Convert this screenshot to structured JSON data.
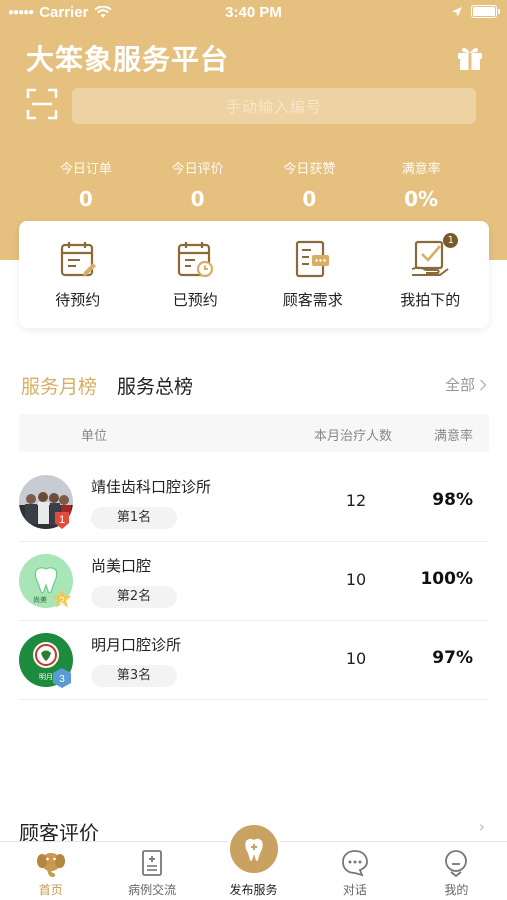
{
  "status_bar": {
    "carrier": "Carrier",
    "time": "3:40 PM"
  },
  "header": {
    "title": "大笨象服务平台",
    "search_placeholder": "手动输入编号"
  },
  "stats": [
    {
      "label": "今日订单",
      "value": "0"
    },
    {
      "label": "今日评价",
      "value": "0"
    },
    {
      "label": "今日获赞",
      "value": "0"
    },
    {
      "label": "满意率",
      "value": "0%"
    }
  ],
  "actions": [
    {
      "label": "待预约",
      "icon": "calendar-edit-icon"
    },
    {
      "label": "已预约",
      "icon": "calendar-clock-icon"
    },
    {
      "label": "顾客需求",
      "icon": "document-chat-icon"
    },
    {
      "label": "我拍下的",
      "icon": "hand-check-icon",
      "badge": "1"
    }
  ],
  "ranking": {
    "tab_active": "服务月榜",
    "tab_other": "服务总榜",
    "view_all": "全部",
    "columns": {
      "unit": "单位",
      "count": "本月治疗人数",
      "satisfaction": "满意率"
    },
    "rows": [
      {
        "name": "靖佳齿科口腔诊所",
        "rank": "第1名",
        "rank_num": "1",
        "count": "12",
        "satisfaction": "98%"
      },
      {
        "name": "尚美口腔",
        "rank": "第2名",
        "rank_num": "2",
        "count": "10",
        "satisfaction": "100%"
      },
      {
        "name": "明月口腔诊所",
        "rank": "第3名",
        "rank_num": "3",
        "count": "10",
        "satisfaction": "97%"
      }
    ]
  },
  "reviews": {
    "title": "顾客评价"
  },
  "tabbar": [
    {
      "label": "首页",
      "icon": "elephant-home-icon",
      "active": true
    },
    {
      "label": "病例交流",
      "icon": "case-record-icon",
      "active": false
    },
    {
      "label": "发布服务",
      "icon": "tooth-add-icon",
      "active": false
    },
    {
      "label": "对话",
      "icon": "chat-bubble-icon",
      "active": false
    },
    {
      "label": "我的",
      "icon": "profile-icon",
      "active": false
    }
  ],
  "colors": {
    "brand_gold": "#E5C07E",
    "accent_gold": "#D9AE63",
    "search_bg": "#EDD3A4"
  }
}
